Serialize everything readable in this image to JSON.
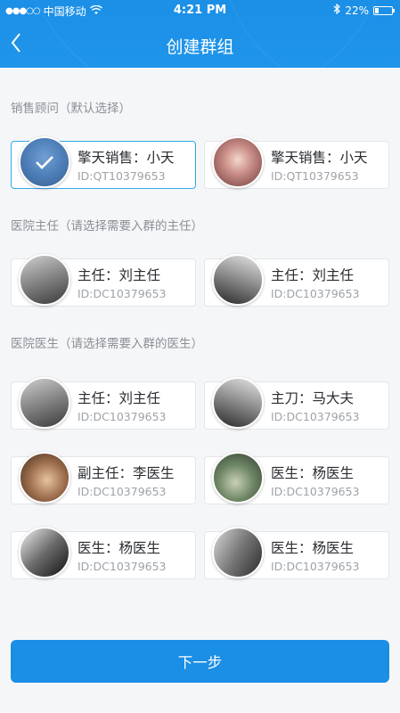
{
  "statusbar": {
    "signal": "●●●○○",
    "carrier": "中国移动",
    "time": "4:21 PM",
    "battery_text": "22%",
    "battery_level": 0.22
  },
  "header": {
    "title": "创建群组"
  },
  "sections": {
    "sales": {
      "title": "销售顾问（默认选择）"
    },
    "chief": {
      "title": "医院主任（请选择需要入群的主任）"
    },
    "doctors": {
      "title": "医院医生（请选择需要入群的医生）"
    }
  },
  "sales_cards": [
    {
      "name": "擎天销售：小天",
      "id": "ID:QT10379653",
      "selected": true
    },
    {
      "name": "擎天销售：小天",
      "id": "ID:QT10379653",
      "selected": false
    }
  ],
  "chief_cards": [
    {
      "name": "主任：刘主任",
      "id": "ID:DC10379653"
    },
    {
      "name": "主任：刘主任",
      "id": "ID:DC10379653"
    }
  ],
  "doctor_cards": [
    {
      "name": "主任：刘主任",
      "id": "ID:DC10379653"
    },
    {
      "name": "主刀：马大夫",
      "id": "ID:DC10379653"
    },
    {
      "name": "副主任：李医生",
      "id": "ID:DC10379653"
    },
    {
      "name": "医生：杨医生",
      "id": "ID:DC10379653"
    },
    {
      "name": "医生：杨医生",
      "id": "ID:DC10379653"
    },
    {
      "name": "医生：杨医生",
      "id": "ID:DC10379653"
    }
  ],
  "footer": {
    "next_label": "下一步"
  },
  "colors": {
    "brand": "#1b8ee5",
    "selected_border": "#32a9e8",
    "background": "#f5f6f8"
  }
}
